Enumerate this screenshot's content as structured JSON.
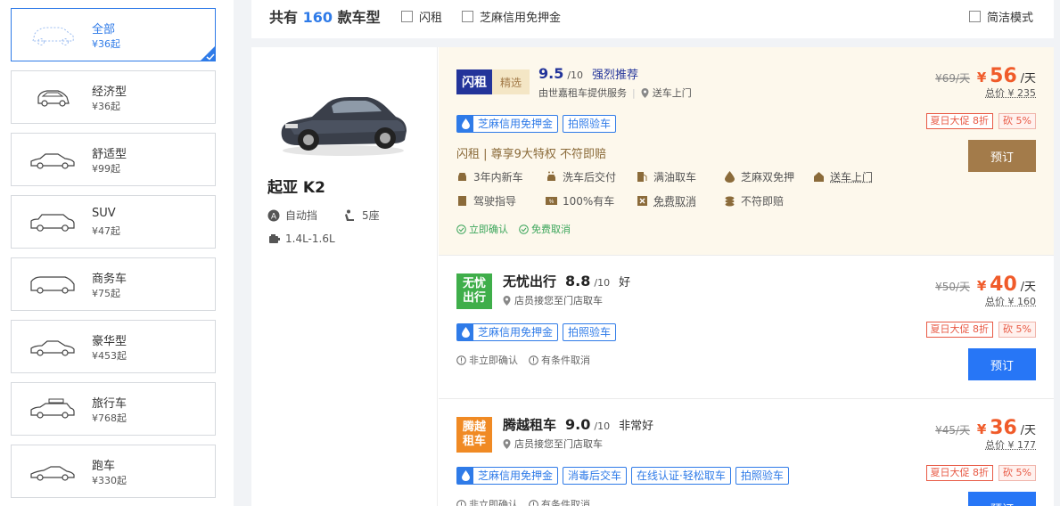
{
  "sidebar": {
    "categories": [
      {
        "name": "全部",
        "price": "¥36起",
        "icon": "car-outline-icon",
        "active": true
      },
      {
        "name": "经济型",
        "price": "¥36起",
        "icon": "hatchback-icon"
      },
      {
        "name": "舒适型",
        "price": "¥99起",
        "icon": "sedan-icon"
      },
      {
        "name": "SUV",
        "price": "¥47起",
        "icon": "suv-icon"
      },
      {
        "name": "商务车",
        "price": "¥75起",
        "icon": "van-icon"
      },
      {
        "name": "豪华型",
        "price": "¥453起",
        "icon": "luxury-car-icon"
      },
      {
        "name": "旅行车",
        "price": "¥768起",
        "icon": "wagon-icon"
      },
      {
        "name": "跑车",
        "price": "¥330起",
        "icon": "sports-car-icon"
      }
    ]
  },
  "topbar": {
    "count_prefix": "共有",
    "count_number": "160",
    "count_suffix": "款车型",
    "filter_flash": "闪租",
    "filter_zhima": "芝麻信用免押金",
    "simple_mode": "简洁模式"
  },
  "car": {
    "model": "起亚 K2",
    "transmission": "自动挡",
    "seats": "5座",
    "engine": "1.4L-1.6L"
  },
  "offers": [
    {
      "brand_text": "闪租",
      "brand_badge": "精选",
      "score": "9.5",
      "score_max": "/10",
      "rating_text": "强烈推荐",
      "provider": "由世嘉租车提供服务",
      "location": "送车上门",
      "tags": [
        "芝麻信用免押金",
        "拍照验车"
      ],
      "privilege": "闪租 | 尊享9大特权 不符即赔",
      "features": [
        "3年内新车",
        "洗车后交付",
        "满油取车",
        "芝麻双免押",
        "送车上门",
        "驾驶指导",
        "100%有车",
        "免费取消",
        "不符即赔"
      ],
      "notes": [
        "立即确认",
        "免费取消"
      ],
      "old_price": "¥69/天",
      "currency": "¥",
      "price": "56",
      "per_day": "/天",
      "total": "总价 ¥ 235",
      "promo": "夏日大促 8折",
      "bargain": "砍",
      "bargain_pct": "5%",
      "button": "预订"
    },
    {
      "brand_text": "无忧出行",
      "brand_name": "无忧出行",
      "score": "8.8",
      "score_max": "/10",
      "rating_text": "好",
      "location": "店员接您至门店取车",
      "tags": [
        "芝麻信用免押金",
        "拍照验车"
      ],
      "notes": [
        "非立即确认",
        "有条件取消"
      ],
      "old_price": "¥50/天",
      "currency": "¥",
      "price": "40",
      "per_day": "/天",
      "total": "总价 ¥ 160",
      "promo": "夏日大促 8折",
      "bargain": "砍",
      "bargain_pct": "5%",
      "button": "预订"
    },
    {
      "brand_text": "腾越租车",
      "brand_name": "腾越租车",
      "score": "9.0",
      "score_max": "/10",
      "rating_text": "非常好",
      "location": "店员接您至门店取车",
      "tags": [
        "芝麻信用免押金",
        "消毒后交车",
        "在线认证·轻松取车",
        "拍照验车"
      ],
      "notes": [
        "非立即确认",
        "有条件取消"
      ],
      "old_price": "¥45/天",
      "currency": "¥",
      "price": "36",
      "per_day": "/天",
      "total": "总价 ¥ 177",
      "promo": "夏日大促 8折",
      "bargain": "砍",
      "bargain_pct": "5%",
      "button": "预订"
    }
  ],
  "colors": {
    "accent": "#2f7be8",
    "price": "#f05b2a",
    "gold": "#a37b4a",
    "highlight_bg": "#fdf8ec"
  }
}
